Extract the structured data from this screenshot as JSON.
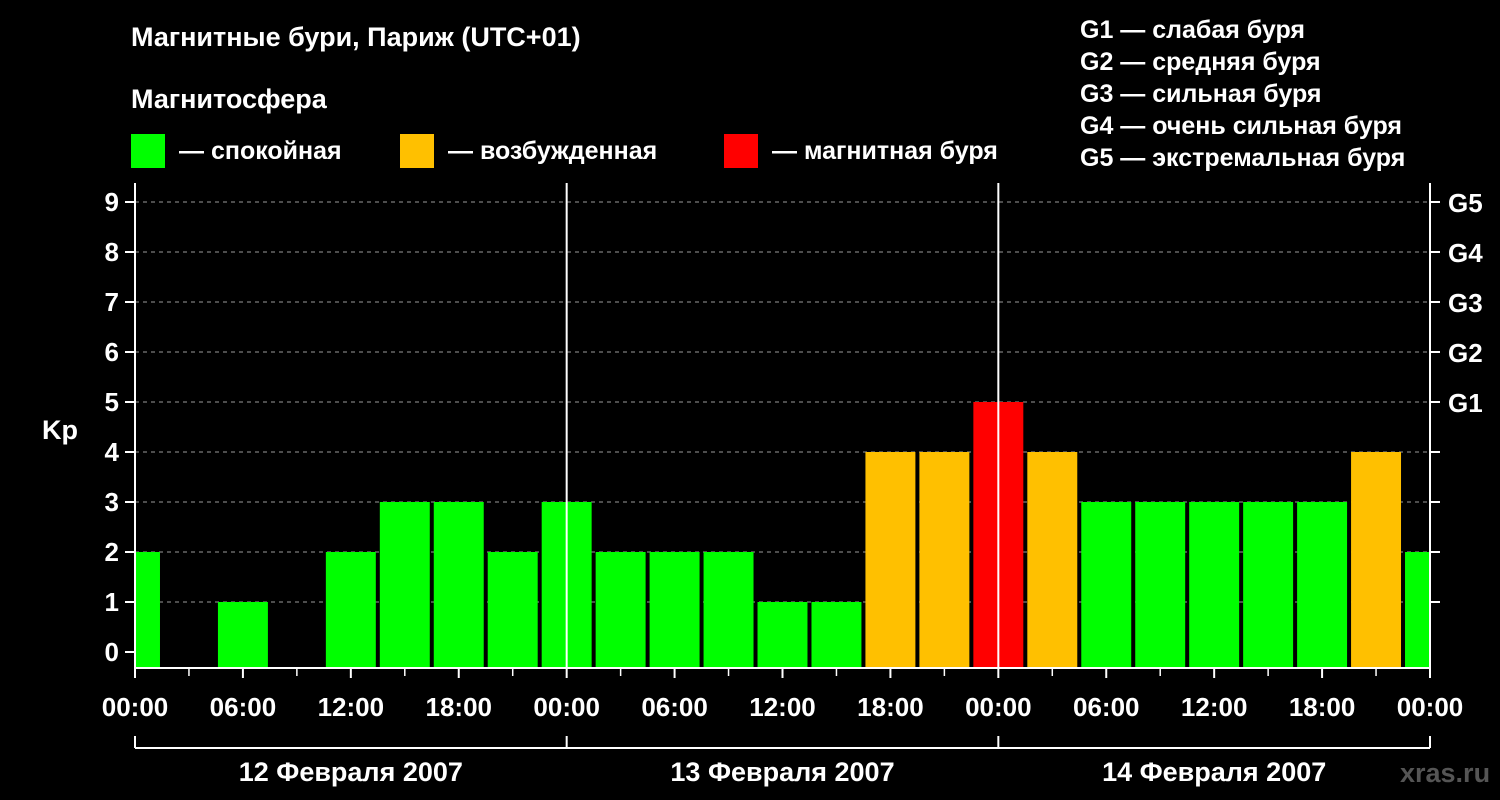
{
  "chart_data": {
    "type": "bar",
    "title": "Магнитные бури, Париж (UTC+01)",
    "subtitle": "Магнитосфера",
    "ylabel": "Kp",
    "ylim": [
      0,
      9
    ],
    "yticks": [
      "0",
      "1",
      "2",
      "3",
      "4",
      "5",
      "6",
      "7",
      "8",
      "9"
    ],
    "right_axis": [
      {
        "kp": 5,
        "label": "G1"
      },
      {
        "kp": 6,
        "label": "G2"
      },
      {
        "kp": 7,
        "label": "G3"
      },
      {
        "kp": 8,
        "label": "G4"
      },
      {
        "kp": 9,
        "label": "G5"
      }
    ],
    "x_tick_labels": [
      "00:00",
      "06:00",
      "12:00",
      "18:00",
      "00:00",
      "06:00",
      "12:00",
      "18:00",
      "00:00",
      "06:00",
      "12:00",
      "18:00",
      "00:00"
    ],
    "days": [
      "12 Февраля 2007",
      "13 Февраля 2007",
      "14 Февраля 2007"
    ],
    "interval_hours": 3,
    "values": [
      2,
      0,
      1,
      0,
      2,
      3,
      3,
      2,
      3,
      2,
      2,
      2,
      1,
      1,
      4,
      4,
      5,
      4,
      3,
      3,
      3,
      3,
      3,
      4,
      2
    ],
    "categories_colors": {
      "quiet": "#00ff00",
      "active": "#ffc000",
      "storm": "#ff0000"
    },
    "grid": true
  },
  "legend": {
    "quiet_label": "— спокойная",
    "active_label": "— возбужденная",
    "storm_label": "— магнитная буря",
    "quiet_color": "#00ff00",
    "active_color": "#ffc000",
    "storm_color": "#ff0000"
  },
  "g_levels": [
    "G1 — слабая буря",
    "G2 — средняя буря",
    "G3 — сильная буря",
    "G4 — очень сильная буря",
    "G5 — экстремальная буря"
  ],
  "watermark": "xras.ru"
}
